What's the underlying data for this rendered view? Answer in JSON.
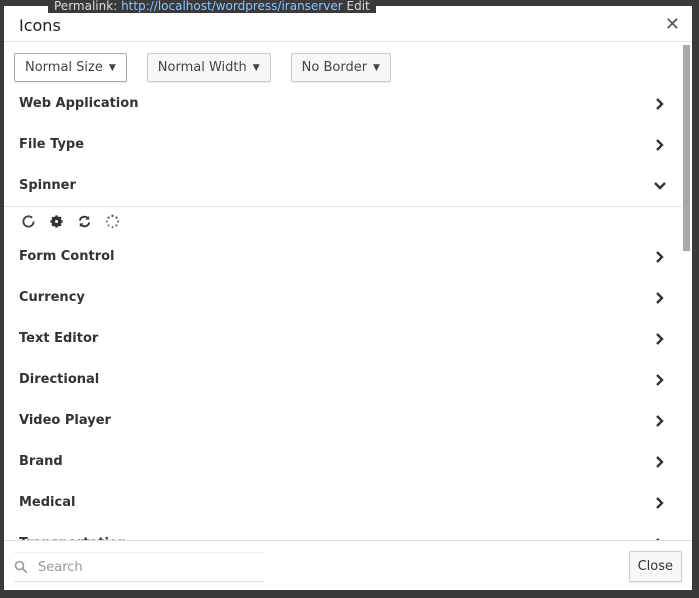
{
  "background": {
    "permalink_label": "Permalink:",
    "permalink_url": "http://localhost/wordpress/iranserver",
    "edit": "Edit"
  },
  "modal": {
    "title": "Icons",
    "close_icon": "close-icon"
  },
  "toolbar": {
    "size": "Normal Size",
    "width": "Normal Width",
    "border": "No Border"
  },
  "categories": [
    {
      "label": "Web Application",
      "expanded": false
    },
    {
      "label": "File Type",
      "expanded": false
    },
    {
      "label": "Spinner",
      "expanded": true,
      "icons": [
        "circle-o-notch-icon",
        "cog-icon",
        "refresh-icon",
        "spinner-icon"
      ]
    },
    {
      "label": "Form Control",
      "expanded": false
    },
    {
      "label": "Currency",
      "expanded": false
    },
    {
      "label": "Text Editor",
      "expanded": false
    },
    {
      "label": "Directional",
      "expanded": false
    },
    {
      "label": "Video Player",
      "expanded": false
    },
    {
      "label": "Brand",
      "expanded": false
    },
    {
      "label": "Medical",
      "expanded": false
    },
    {
      "label": "Transportation",
      "expanded": false
    }
  ],
  "footer": {
    "search_placeholder": "Search",
    "search_value": "",
    "close_label": "Close"
  }
}
